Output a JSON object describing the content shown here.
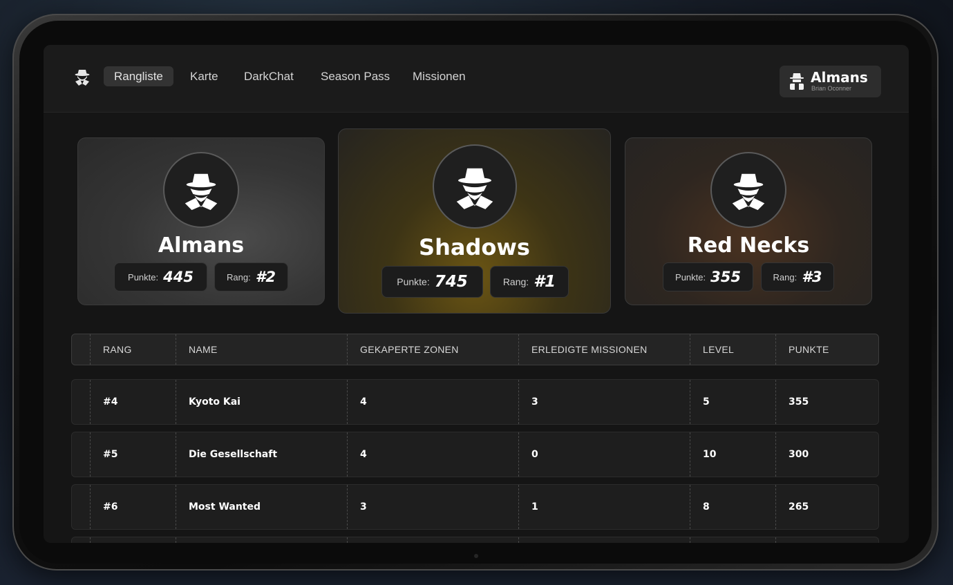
{
  "nav": {
    "items": [
      {
        "label": "Rangliste",
        "active": true
      },
      {
        "label": "Karte",
        "active": false
      },
      {
        "label": "DarkChat",
        "active": false
      },
      {
        "label": "Season Pass",
        "active": false
      },
      {
        "label": "Missionen",
        "active": false
      }
    ]
  },
  "profile": {
    "name": "Almans",
    "subtitle": "Brian Oconner",
    "icon": "spy-icon"
  },
  "podium": [
    {
      "team": "Almans",
      "points_label": "Punkte:",
      "points": "445",
      "rank_label": "Rang:",
      "rank": "#2",
      "tier_color": "#3a3a3a"
    },
    {
      "team": "Shadows",
      "points_label": "Punkte:",
      "points": "745",
      "rank_label": "Rang:",
      "rank": "#1",
      "tier_color": "#6b5514"
    },
    {
      "team": "Red Necks",
      "points_label": "Punkte:",
      "points": "355",
      "rank_label": "Rang:",
      "rank": "#3",
      "tier_color": "#4a3220"
    }
  ],
  "table": {
    "headers": [
      "RANG",
      "NAME",
      "GEKAPERTE ZONEN",
      "ERLEDIGTE MISSIONEN",
      "LEVEL",
      "PUNKTE"
    ],
    "rows": [
      [
        "#4",
        "Kyoto Kai",
        "4",
        "3",
        "5",
        "355"
      ],
      [
        "#5",
        "Die Gesellschaft",
        "4",
        "0",
        "10",
        "300"
      ],
      [
        "#6",
        "Most Wanted",
        "3",
        "1",
        "8",
        "265"
      ]
    ]
  }
}
